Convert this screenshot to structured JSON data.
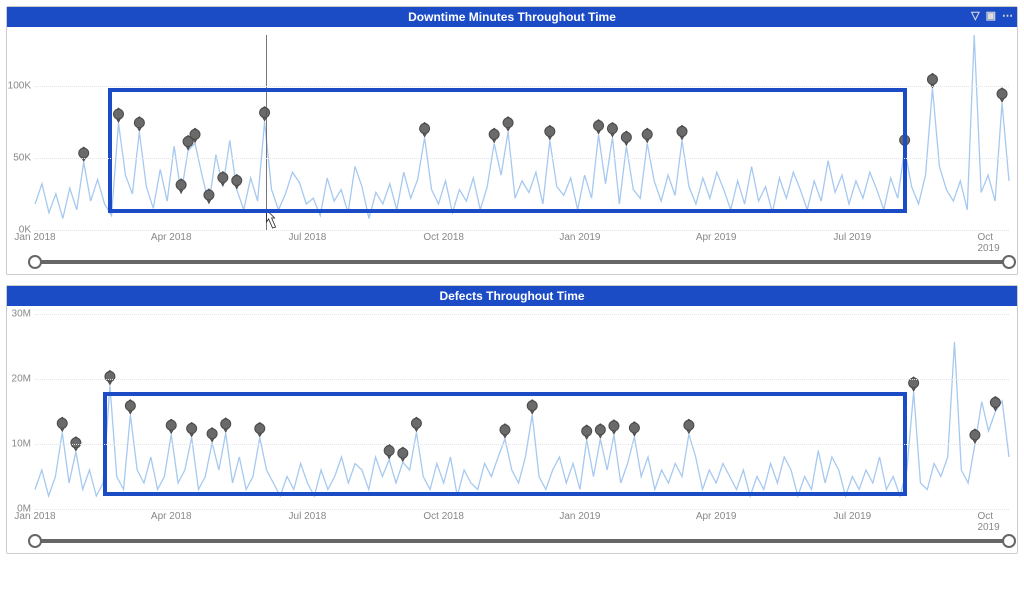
{
  "toolbar_icons": {
    "filter": "filter-icon",
    "focus": "focus-icon",
    "more": "more-icon"
  },
  "charts": [
    {
      "title": "Downtime Minutes Throughout Time",
      "y_ticks": [
        "0K",
        "50K",
        "100K"
      ],
      "x_ticks": [
        "Jan 2018",
        "Apr 2018",
        "Jul 2018",
        "Oct 2018",
        "Jan 2019",
        "Apr 2019",
        "Jul 2019",
        "Oct 2019"
      ]
    },
    {
      "title": "Defects Throughout Time",
      "y_ticks": [
        "0M",
        "10M",
        "20M",
        "30M"
      ],
      "x_ticks": [
        "Jan 2018",
        "Apr 2018",
        "Jul 2018",
        "Oct 2018",
        "Jan 2019",
        "Apr 2019",
        "Jul 2019",
        "Oct 2019"
      ]
    }
  ],
  "chart_data": [
    {
      "type": "line",
      "title": "Downtime Minutes Throughout Time",
      "xlabel": "",
      "ylabel": "",
      "x_range": [
        "2018-01-01",
        "2019-11-30"
      ],
      "ylim": [
        0,
        135000
      ],
      "series": [
        {
          "name": "Downtime Minutes",
          "values": [
            18,
            32,
            12,
            25,
            8,
            29,
            14,
            47,
            20,
            35,
            18,
            10,
            74,
            38,
            25,
            68,
            30,
            15,
            42,
            20,
            58,
            25,
            55,
            60,
            38,
            18,
            52,
            30,
            62,
            28,
            14,
            36,
            20,
            75,
            28,
            14,
            25,
            40,
            33,
            18,
            22,
            10,
            36,
            20,
            28,
            12,
            44,
            30,
            8,
            26,
            18,
            32,
            14,
            40,
            22,
            35,
            64,
            28,
            18,
            34,
            12,
            28,
            20,
            36,
            14,
            30,
            60,
            38,
            68,
            22,
            34,
            26,
            40,
            18,
            62,
            30,
            24,
            36,
            14,
            38,
            22,
            66,
            32,
            64,
            18,
            58,
            28,
            22,
            60,
            34,
            20,
            38,
            24,
            62,
            30,
            18,
            36,
            22,
            40,
            28,
            14,
            34,
            18,
            44,
            20,
            30,
            12,
            36,
            22,
            40,
            28,
            14,
            34,
            20,
            48,
            26,
            38,
            18,
            34,
            22,
            40,
            28,
            14,
            36,
            22,
            56,
            30,
            18,
            38,
            98,
            44,
            28,
            20,
            34,
            14,
            135,
            26,
            38,
            20,
            88,
            34
          ]
        }
      ],
      "anomalies_x_idx": [
        7,
        12,
        15,
        21,
        22,
        23,
        25,
        27,
        29,
        33,
        56,
        66,
        68,
        74,
        81,
        83,
        85,
        88,
        93,
        125,
        129,
        139
      ],
      "x_tick_labels": [
        "Jan 2018",
        "Apr 2018",
        "Jul 2018",
        "Oct 2018",
        "Jan 2019",
        "Apr 2019",
        "Jul 2019",
        "Oct 2019"
      ],
      "annotation_box": {
        "x0_frac": 0.075,
        "x1_frac": 0.895,
        "y0": 12,
        "y1": 98
      }
    },
    {
      "type": "line",
      "title": "Defects Throughout Time",
      "xlabel": "",
      "ylabel": "",
      "x_range": [
        "2018-01-01",
        "2019-11-30"
      ],
      "ylim": [
        0,
        30
      ],
      "series": [
        {
          "name": "Defects",
          "values": [
            3,
            6,
            2,
            5,
            11.8,
            4,
            8.8,
            3,
            6,
            2,
            4,
            19,
            5,
            3,
            14.5,
            6,
            4,
            8,
            3,
            5,
            11.5,
            4,
            6,
            11,
            3,
            5,
            10.2,
            6,
            11.7,
            4,
            8,
            3,
            5,
            11,
            6,
            4,
            2,
            5,
            3,
            7,
            4,
            2,
            6,
            3,
            5,
            8,
            4,
            7,
            6,
            3,
            8,
            5,
            7.6,
            4,
            7.2,
            6,
            11.8,
            5,
            3,
            7,
            4,
            8,
            2,
            6,
            4,
            3,
            7,
            5,
            8,
            10.8,
            6,
            4,
            8,
            14.5,
            5,
            3,
            6,
            8,
            4,
            7,
            3,
            10.6,
            5,
            10.8,
            6,
            11.4,
            4,
            7,
            11.1,
            5,
            8,
            3,
            6,
            4,
            7,
            5,
            11.5,
            8,
            3,
            6,
            4,
            7,
            5,
            3,
            6,
            2,
            5,
            3,
            7,
            4,
            8,
            6,
            2,
            5,
            3,
            9,
            4,
            8,
            6,
            2,
            5,
            3,
            6,
            4,
            8,
            3,
            5,
            2,
            6,
            18,
            4,
            3,
            7,
            5,
            8,
            25.7,
            6,
            4,
            10,
            16.5,
            12,
            15,
            16.6,
            8
          ]
        }
      ],
      "anomalies_x_idx": [
        4,
        6,
        11,
        14,
        20,
        23,
        26,
        28,
        33,
        52,
        54,
        56,
        69,
        73,
        81,
        83,
        85,
        88,
        96,
        129,
        138,
        141
      ],
      "x_tick_labels": [
        "Jan 2018",
        "Apr 2018",
        "Jul 2018",
        "Oct 2018",
        "Jan 2019",
        "Apr 2019",
        "Jul 2019",
        "Oct 2019"
      ],
      "annotation_box": {
        "x0_frac": 0.07,
        "x1_frac": 0.895,
        "y0": 2,
        "y1": 18
      }
    }
  ]
}
